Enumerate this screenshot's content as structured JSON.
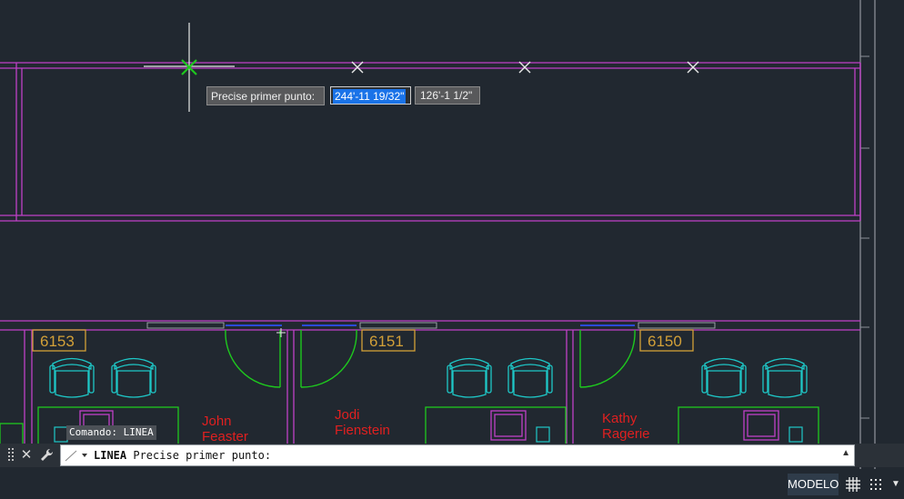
{
  "drawing": {
    "rooms": [
      {
        "number": "6153",
        "occupant": [
          "John",
          "Feaster"
        ]
      },
      {
        "number": "6151",
        "occupant": [
          "Jodi",
          "Fienstein"
        ]
      },
      {
        "number": "6150",
        "occupant": [
          "Kathy",
          "Ragerie"
        ]
      }
    ]
  },
  "dynamic_input": {
    "prompt_label": "Precise primer punto:",
    "x_value": "244'-11 19/32\"",
    "y_value": "126'-1 1/2\""
  },
  "command_line": {
    "history": "Comando: LINEA",
    "command": "LINEA",
    "prompt": "Precise primer punto:",
    "close_icon": "close-icon",
    "customize_icon": "wrench-icon"
  },
  "status_bar": {
    "model_label": "MODELO",
    "grid_icon": "grid-icon",
    "snap_icon": "snap-icon",
    "menu_icon": "chevron-down-icon"
  },
  "colors": {
    "background": "#212830",
    "walls": "#c040c8",
    "doors": "#1ec81e",
    "furniture": "#1ec8c8",
    "desk": "#1ec81e",
    "room_tag": "#d2a038",
    "occupant_text": "#e02020",
    "windows": "#2a4ad8"
  }
}
